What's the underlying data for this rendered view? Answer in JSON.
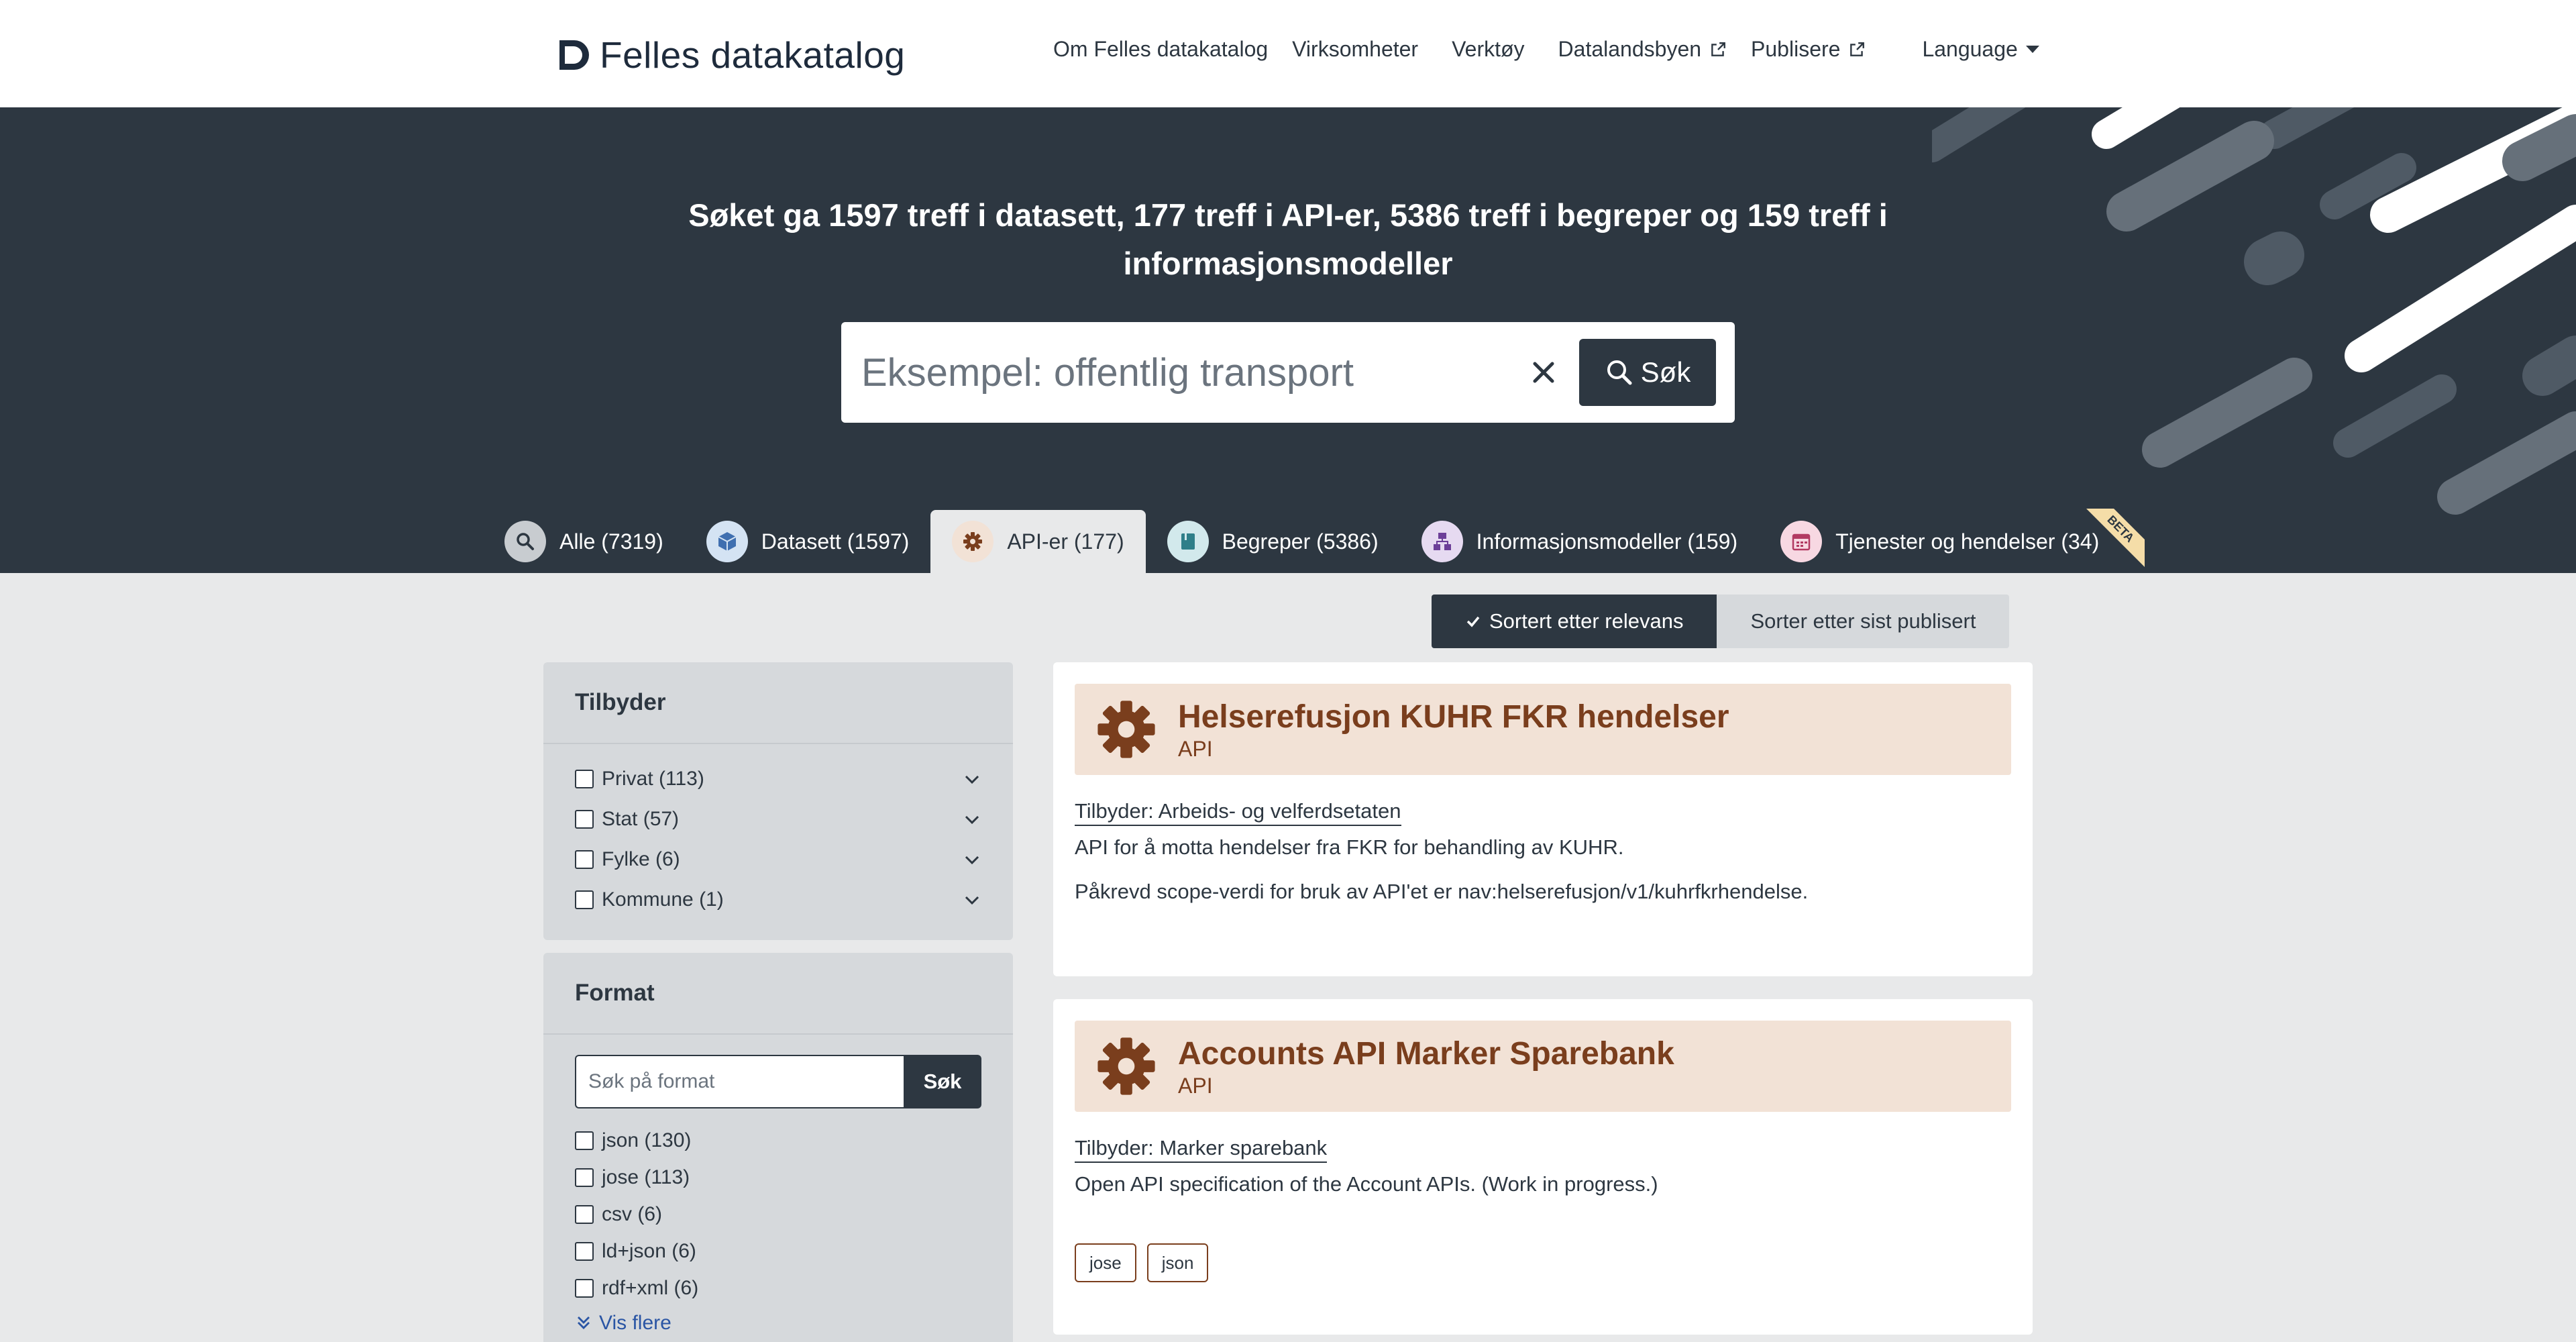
{
  "header": {
    "logo_text": "Felles datakatalog",
    "nav": [
      {
        "label": "Om Felles datakatalog"
      },
      {
        "label": "Virksomheter"
      },
      {
        "label": "Verktøy"
      },
      {
        "label": "Datalandsbyen",
        "external": true
      },
      {
        "label": "Publisere",
        "external": true
      },
      {
        "label": "Language",
        "dropdown": true
      }
    ]
  },
  "hero": {
    "title": "Søket ga 1597 treff i datasett, 177 treff i API-er, 5386 treff i begreper og 159 treff i informasjonsmodeller",
    "search": {
      "placeholder": "Eksempel: offentlig transport",
      "button_label": "Søk"
    }
  },
  "tabs": [
    {
      "label": "Alle (7319)",
      "icon": "search-icon",
      "color": "#c8ccd0"
    },
    {
      "label": "Datasett (1597)",
      "icon": "dataset-icon",
      "color": "#d4e3f3"
    },
    {
      "label": "API-er (177)",
      "icon": "gear-icon",
      "color": "#f2e2d6",
      "active": true
    },
    {
      "label": "Begreper (5386)",
      "icon": "book-icon",
      "color": "#d2e9ec"
    },
    {
      "label": "Informasjonsmodeller (159)",
      "icon": "model-icon",
      "color": "#e6daf1"
    },
    {
      "label": "Tjenester og hendelser (34)",
      "icon": "calendar-icon",
      "color": "#f7d8e2",
      "badge": "BETA"
    }
  ],
  "sort": {
    "active_label": "Sortert etter relevans",
    "inactive_label": "Sorter etter sist publisert"
  },
  "filters": {
    "provider": {
      "title": "Tilbyder",
      "items": [
        {
          "label": "Privat (113)"
        },
        {
          "label": "Stat (57)"
        },
        {
          "label": "Fylke (6)"
        },
        {
          "label": "Kommune (1)"
        }
      ]
    },
    "format": {
      "title": "Format",
      "search_placeholder": "Søk på format",
      "search_button": "Søk",
      "items": [
        {
          "label": "json (130)"
        },
        {
          "label": "jose (113)"
        },
        {
          "label": "csv (6)"
        },
        {
          "label": "ld+json (6)"
        },
        {
          "label": "rdf+xml (6)"
        }
      ],
      "show_more": "Vis flere"
    }
  },
  "results": [
    {
      "title": "Helserefusjon KUHR FKR hendelser",
      "type": "API",
      "publisher": "Tilbyder: Arbeids- og velferdsetaten",
      "description": "API for å motta hendelser fra FKR for behandling av KUHR.",
      "description2": "Påkrevd scope-verdi for bruk av API'et er nav:helserefusjon/v1/kuhrfkrhendelse."
    },
    {
      "title": "Accounts API Marker Sparebank",
      "type": "API",
      "publisher": "Tilbyder: Marker sparebank",
      "description": "Open API specification of the Account APIs. (Work in progress.)",
      "tags": [
        "jose",
        "json"
      ]
    }
  ],
  "colors": {
    "dark": "#2d3741",
    "api_accent": "#7a3e1d",
    "api_bg": "#f2e2d6",
    "page_bg": "#e8e9ea"
  }
}
